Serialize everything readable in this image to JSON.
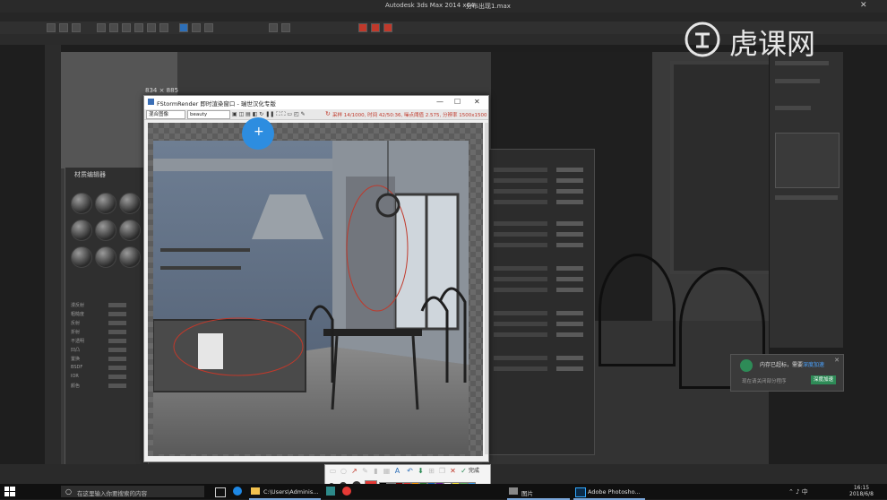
{
  "max": {
    "title": "Autodesk 3ds Max 2014 x64",
    "file": "分布出现1.max"
  },
  "fstorm": {
    "title": "FStormRender 即时渲染窗口 - 瑞世汉化专版",
    "size_label": "834 × 885",
    "channel": "混合图像",
    "layer": "beauty",
    "status": "采样 14/1000, 时间 42/50:36, 噪点阈值 2.575, 分辨率 1500x1500"
  },
  "materials": {
    "title": "材质编辑器",
    "props": [
      "漫反射",
      "粗糙度",
      "反射",
      "折射",
      "不透明",
      "凹凸",
      "置换",
      "BSDF",
      "IOR",
      "颜色"
    ]
  },
  "notification": {
    "text": "内存已超标，需要",
    "link": "深度加速",
    "sub": "现在请关闭部分程序",
    "button": "深度加速"
  },
  "snip": {
    "done": "完成"
  },
  "watermark": {
    "brand": "虎课网"
  },
  "taskbar": {
    "search_placeholder": "在这里输入你要搜索的内容",
    "apps": [
      {
        "label": "C:\\Users\\Adminis..."
      },
      {
        "label": "图片"
      },
      {
        "label": "Adobe Photosho..."
      }
    ],
    "time": "16:15",
    "date": "2018/6/8"
  },
  "colors": {
    "accent_blue": "#2d8de0",
    "snip_red": "#e53935",
    "notify_green": "#2e8b57"
  }
}
